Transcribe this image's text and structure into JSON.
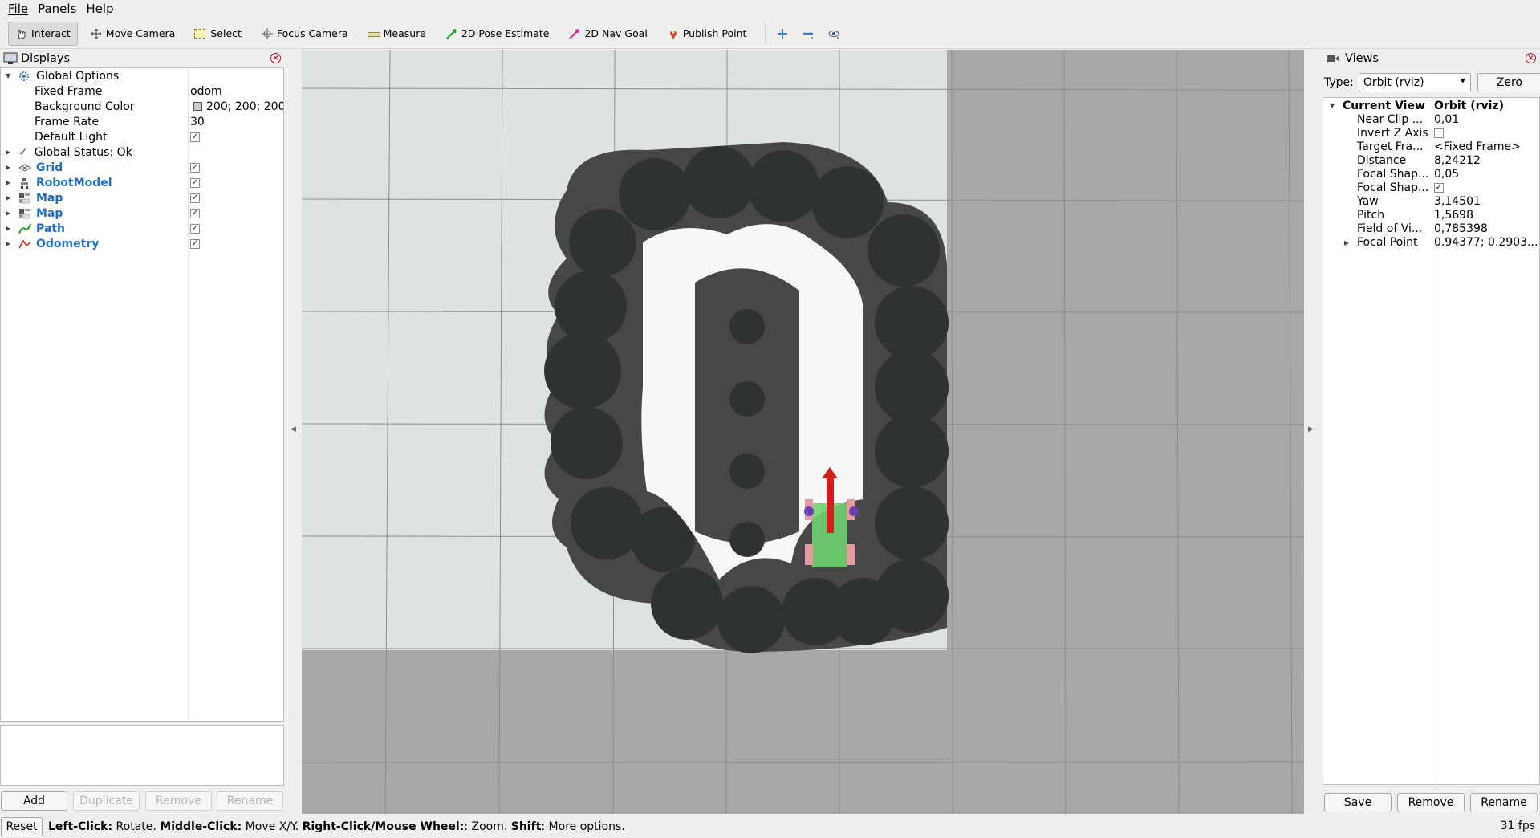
{
  "menubar": {
    "file": "File",
    "panels": "Panels",
    "help": "Help"
  },
  "toolbar": {
    "interact": "Interact",
    "move_camera": "Move Camera",
    "select": "Select",
    "focus_camera": "Focus Camera",
    "measure": "Measure",
    "pose_estimate": "2D Pose Estimate",
    "nav_goal": "2D Nav Goal",
    "publish_point": "Publish Point"
  },
  "displays": {
    "title": "Displays",
    "global_options": "Global Options",
    "props": [
      {
        "label": "Fixed Frame",
        "value": "odom"
      },
      {
        "label": "Background Color",
        "value": "200; 200; 200"
      },
      {
        "label": "Frame Rate",
        "value": "30"
      },
      {
        "label": "Default Light",
        "value": "✓"
      }
    ],
    "global_status": "Global Status: Ok",
    "items": [
      {
        "label": "Grid",
        "checked": "✓"
      },
      {
        "label": "RobotModel",
        "checked": "✓"
      },
      {
        "label": "Map",
        "checked": "✓"
      },
      {
        "label": "Map",
        "checked": "✓"
      },
      {
        "label": "Path",
        "checked": "✓"
      },
      {
        "label": "Odometry",
        "checked": "✓"
      }
    ],
    "buttons": {
      "add": "Add",
      "duplicate": "Duplicate",
      "remove": "Remove",
      "rename": "Rename"
    }
  },
  "views": {
    "title": "Views",
    "type_label": "Type:",
    "type_value": "Orbit (rviz)",
    "zero": "Zero",
    "current_view_label": "Current View",
    "current_view_value": "Orbit (rviz)",
    "props": [
      {
        "label": "Near Clip ...",
        "value": "0,01"
      },
      {
        "label": "Invert Z Axis",
        "value": ""
      },
      {
        "label": "Target Fra...",
        "value": "<Fixed Frame>"
      },
      {
        "label": "Distance",
        "value": "8,24212"
      },
      {
        "label": "Focal Shap...",
        "value": "0,05"
      },
      {
        "label": "Focal Shap...",
        "value": "✓"
      },
      {
        "label": "Yaw",
        "value": "3,14501"
      },
      {
        "label": "Pitch",
        "value": "1,5698"
      },
      {
        "label": "Field of Vi...",
        "value": "0,785398"
      },
      {
        "label": "Focal Point",
        "value": "0.94377; 0.2903..."
      }
    ],
    "buttons": {
      "save": "Save",
      "remove": "Remove",
      "rename": "Rename"
    }
  },
  "status": {
    "reset": "Reset",
    "left_click": "Left-Click:",
    "left_click_action": " Rotate. ",
    "middle_click": "Middle-Click:",
    "middle_click_action": " Move X/Y. ",
    "right_click": "Right-Click/Mouse Wheel:",
    "right_click_action": ": Zoom. ",
    "shift": "Shift",
    "shift_action": ": More options.",
    "fps": "31 fps"
  },
  "colors": {
    "background": "#a8a8a8",
    "map_free": "#dde3e3",
    "obstacle_dark": "#2f3232",
    "inflation": "#474747",
    "robot_base": "#6fd06f",
    "arrow": "#d41d1d",
    "item_blue": "#1f6cc7"
  }
}
